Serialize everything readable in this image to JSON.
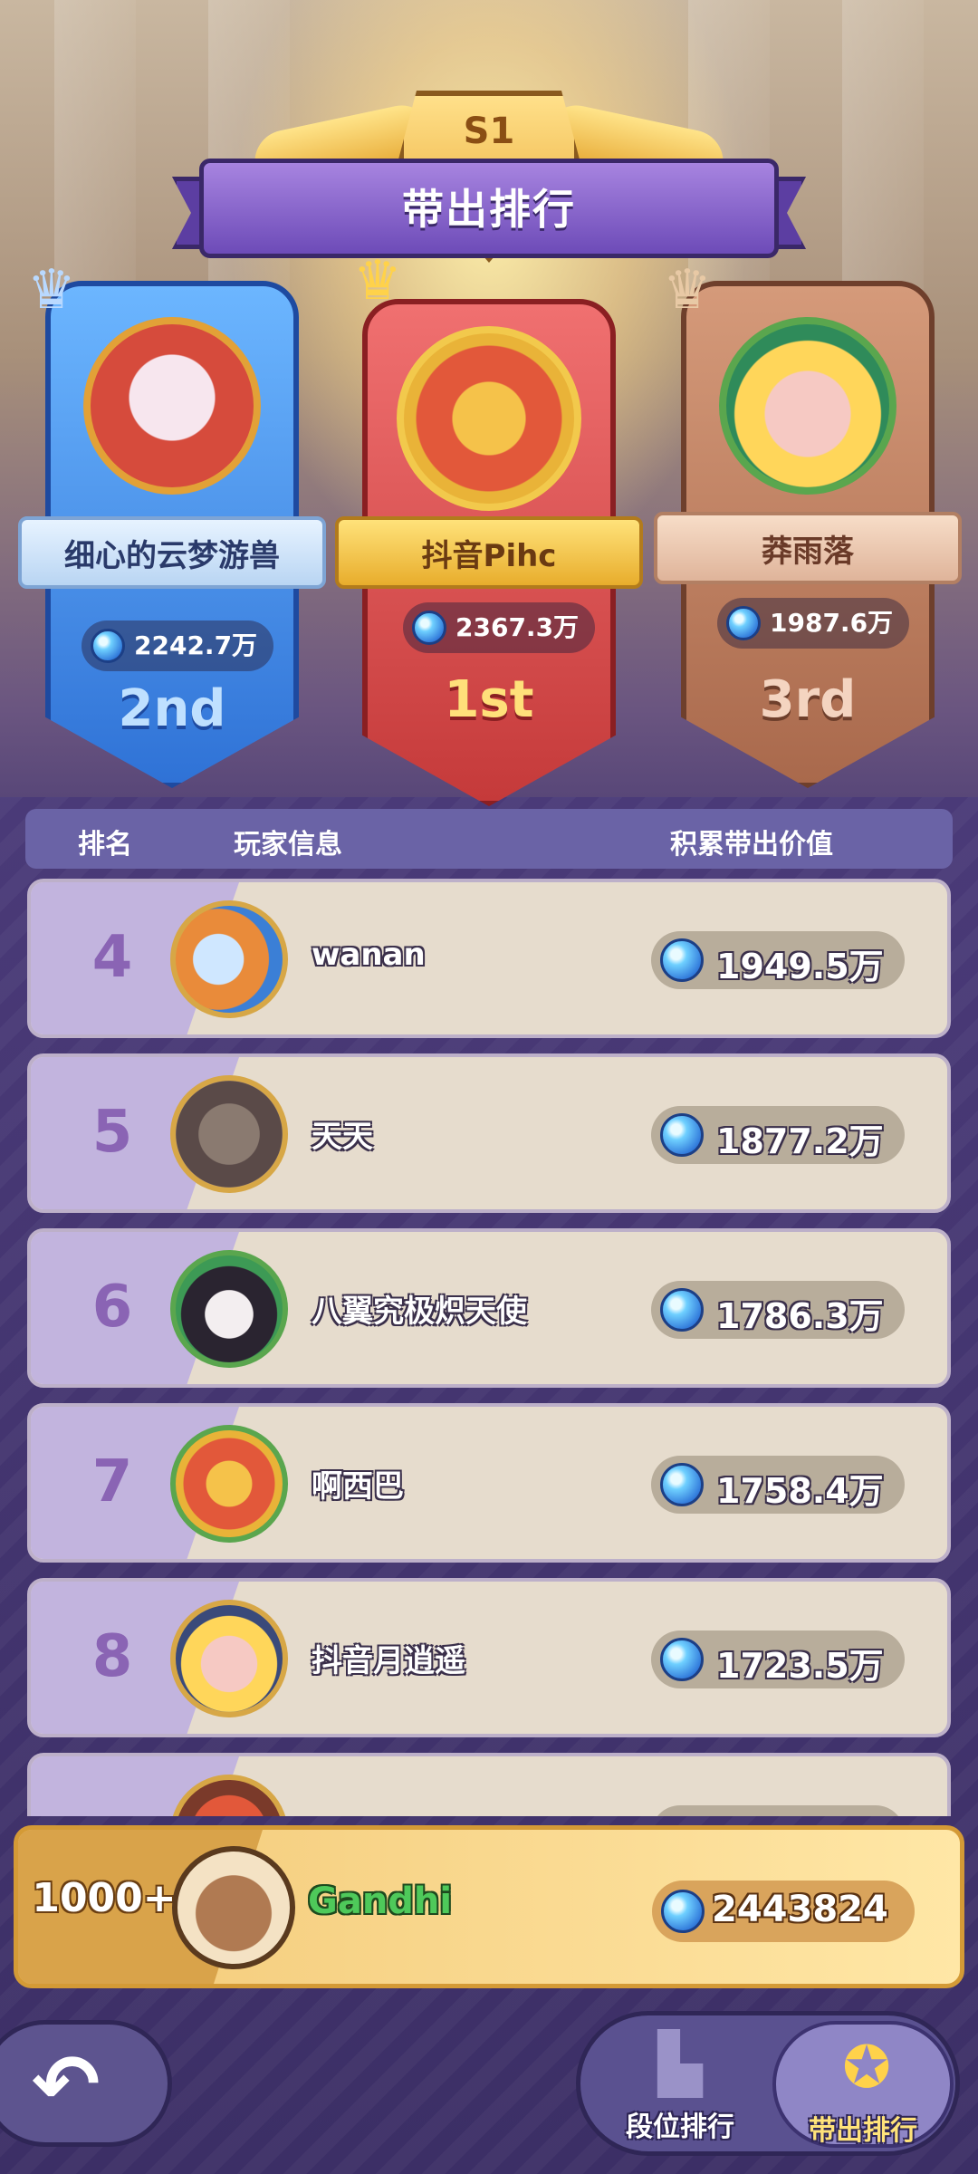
{
  "banner": {
    "season": "S1",
    "title": "带出排行"
  },
  "podium": [
    {
      "place": "2nd",
      "name": "细心的云梦游兽",
      "value": "2242.7万"
    },
    {
      "place": "1st",
      "name": "抖音Pihc",
      "value": "2367.3万"
    },
    {
      "place": "3rd",
      "name": "莽雨落",
      "value": "1987.6万"
    }
  ],
  "table": {
    "col_rank": "排名",
    "col_player": "玩家信息",
    "col_value": "积累带出价值",
    "rows": [
      {
        "rank": "4",
        "name": "wanan",
        "value": "1949.5万"
      },
      {
        "rank": "5",
        "name": "天天",
        "value": "1877.2万"
      },
      {
        "rank": "6",
        "name": "八翼究极炽天使",
        "value": "1786.3万"
      },
      {
        "rank": "7",
        "name": "啊西巴",
        "value": "1758.4万"
      },
      {
        "rank": "8",
        "name": "抖音月逍遥",
        "value": "1723.5万"
      }
    ]
  },
  "self": {
    "rank": "1000+",
    "name": "Gandhi",
    "value": "2443824"
  },
  "nav": {
    "tab_ranking": "段位排行",
    "tab_carry": "带出排行",
    "active_tab": "带出排行"
  },
  "icons": {
    "back": "back-arrow-icon",
    "gem": "gem-icon",
    "crown": "crown-icon",
    "ranking": "podium-icon",
    "carry": "medal-icon"
  },
  "colors": {
    "accent_purple": "#6d4bb8",
    "gold": "#f2c94c",
    "self_name_green": "#4ec95a"
  }
}
